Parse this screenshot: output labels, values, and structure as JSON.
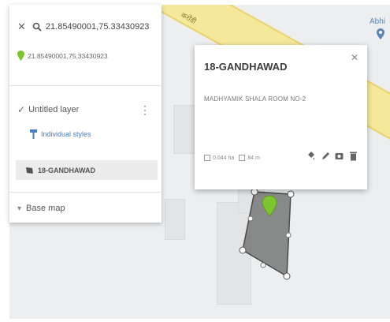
{
  "map": {
    "road_label": "करोंडी",
    "poi_label": "Abhi",
    "colors": {
      "road": "#f6e89a",
      "polygon": "#7d7d7d",
      "pin": "#7cc52f"
    }
  },
  "search": {
    "query": "21.85490001,75.33430923",
    "result": "21.85490001,75.33430923"
  },
  "layer": {
    "name": "Untitled layer",
    "styles_label": "Individual styles",
    "feature_label": "18-GANDHAWAD",
    "base_map_label": "Base map"
  },
  "popup": {
    "title": "18-GANDHAWAD",
    "description": "MADHYAMIK SHALA ROOM NO-2",
    "area": "0.044 ha",
    "perimeter": "84 m"
  }
}
